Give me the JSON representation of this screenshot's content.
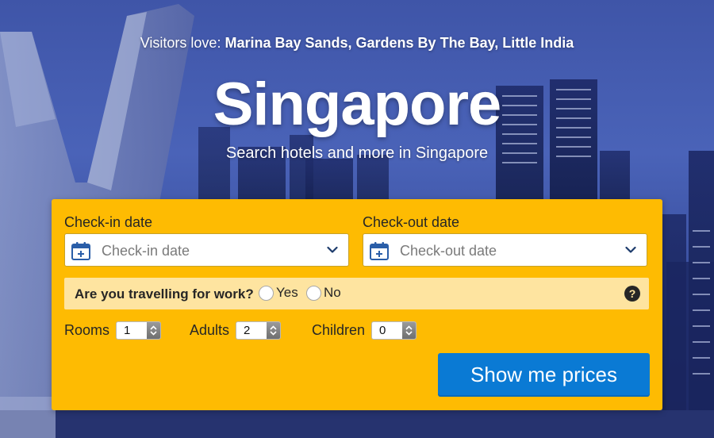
{
  "hero": {
    "visitors_prefix": "Visitors love:",
    "visitors_places": "Marina Bay Sands, Gardens By The Bay, Little India",
    "title": "Singapore",
    "subtitle": "Search hotels and more in Singapore"
  },
  "search": {
    "checkin": {
      "label": "Check-in date",
      "placeholder": "Check-in date",
      "icon": "calendar-icon"
    },
    "checkout": {
      "label": "Check-out date",
      "placeholder": "Check-out date",
      "icon": "calendar-icon"
    },
    "work": {
      "question": "Are you travelling for work?",
      "yes_label": "Yes",
      "no_label": "No",
      "help_label": "?"
    },
    "rooms": {
      "label": "Rooms",
      "value": "1"
    },
    "adults": {
      "label": "Adults",
      "value": "2"
    },
    "children": {
      "label": "Children",
      "value": "0"
    },
    "submit_label": "Show me prices"
  },
  "colors": {
    "panel": "#febb02",
    "work_bar": "#fee4a0",
    "button": "#0a7ad4",
    "calendar_icon": "#2a5ea8"
  }
}
